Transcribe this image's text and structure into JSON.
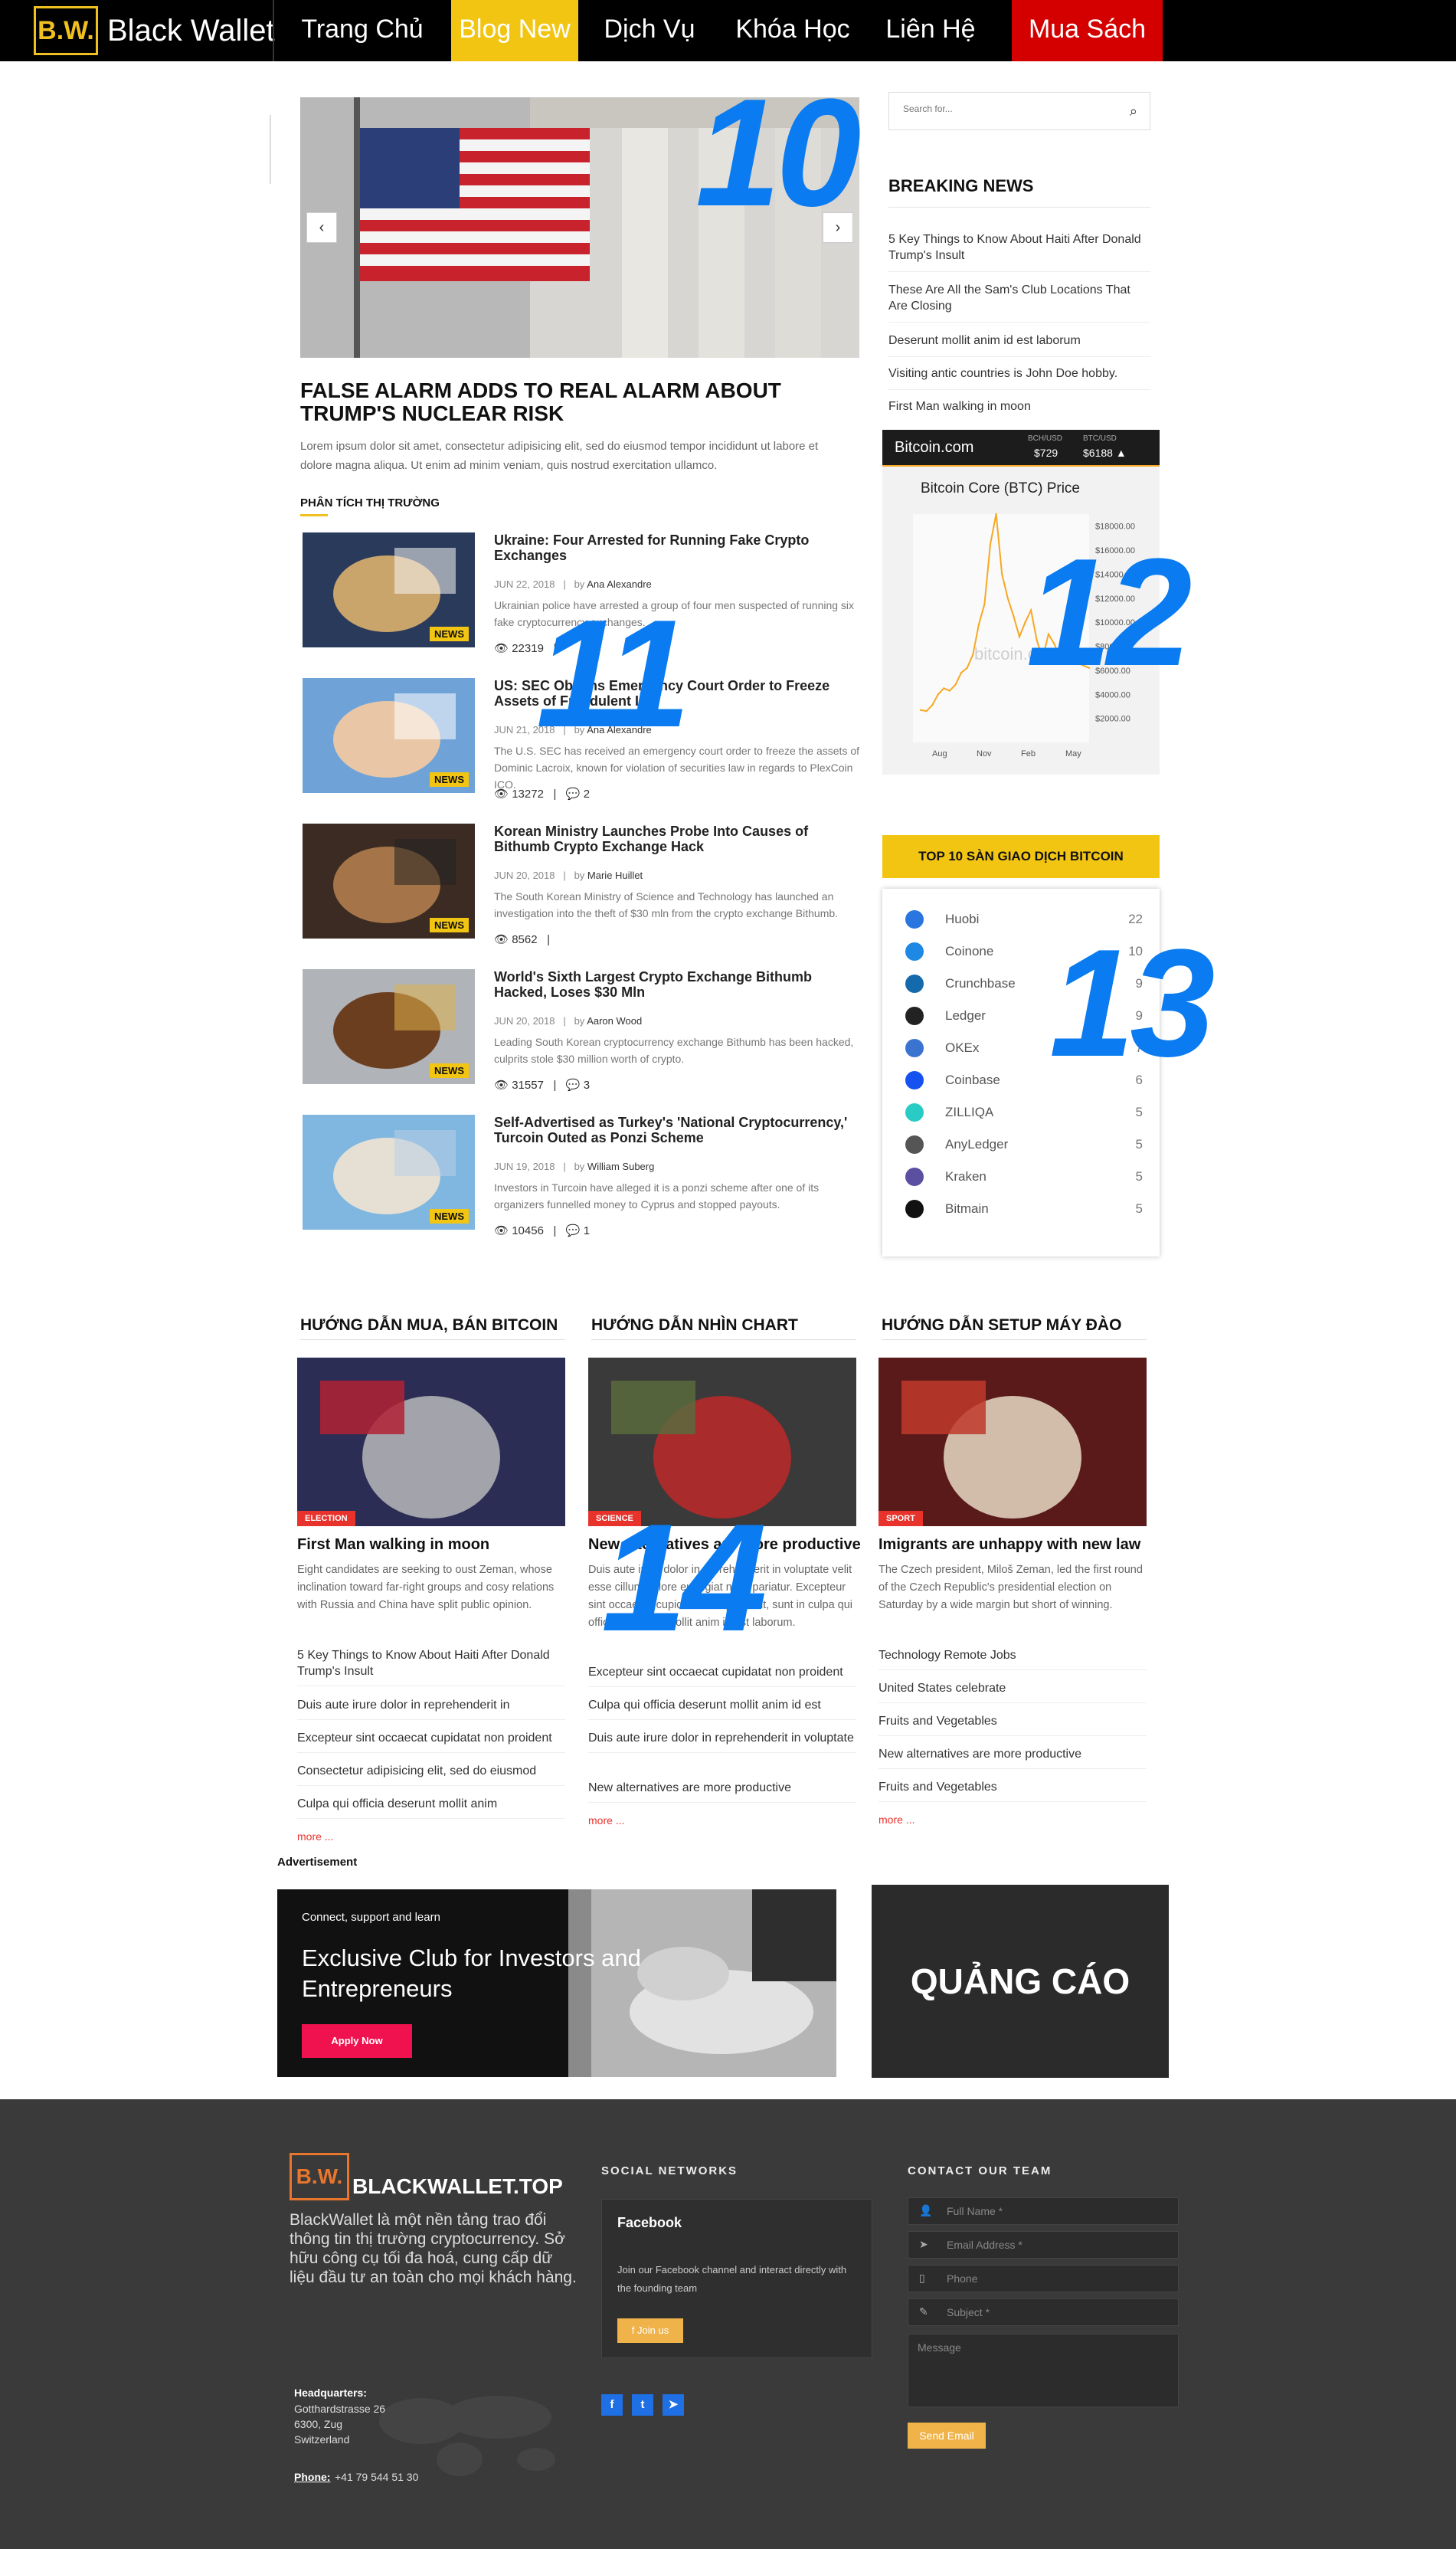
{
  "nav": {
    "logo_mark": "B.W.",
    "logo_text": "Black Wallet",
    "items": [
      "Trang Chủ",
      "Blog New",
      "Dịch Vụ",
      "Khóa Học",
      "Liên Hệ",
      "Mua Sách"
    ],
    "active_index": 1,
    "accent": "#f2c513",
    "cta_color": "#d40000"
  },
  "annotations": [
    "10",
    "11",
    "12",
    "13",
    "14"
  ],
  "hero": {
    "prev_icon": "chevron-left-icon",
    "next_icon": "chevron-right-icon",
    "title": "FALSE ALARM ADDS TO REAL ALARM ABOUT TRUMP'S NUCLEAR RISK",
    "lead": "Lorem ipsum dolor sit amet, consectetur adipisicing elit, sed do eiusmod tempor incididunt ut labore et dolore magna aliqua. Ut enim ad minim veniam, quis nostrud exercitation ullamco."
  },
  "market": {
    "label": "PHÂN TÍCH THỊ TRƯỜNG",
    "articles": [
      {
        "title": "Ukraine: Four Arrested for Running Fake Crypto Exchanges",
        "date": "JUN 22, 2018",
        "by": "by",
        "author": "Ana Alexandre",
        "excerpt": "Ukrainian police have arrested a group of four men suspected of running six fake cryptocurrency exchanges.",
        "views": "22319",
        "comments": "",
        "badge": "NEWS"
      },
      {
        "title": "US: SEC Obtains Emergency Court Order to Freeze Assets of Fraudulent ICO",
        "date": "JUN 21, 2018",
        "by": "by",
        "author": "Ana Alexandre",
        "excerpt": "The U.S. SEC has received an emergency court order to freeze the assets of Dominic Lacroix, known for violation of securities law in regards to PlexCoin ICO.",
        "views": "13272",
        "comments": "2",
        "badge": "NEWS"
      },
      {
        "title": "Korean Ministry Launches Probe Into Causes of Bithumb Crypto Exchange Hack",
        "date": "JUN 20, 2018",
        "by": "by",
        "author": "Marie Huillet",
        "excerpt": "The South Korean Ministry of Science and Technology has launched an investigation into the theft of $30 mln from the crypto exchange Bithumb.",
        "views": "8562",
        "comments": "",
        "badge": "NEWS"
      },
      {
        "title": "World's Sixth Largest Crypto Exchange Bithumb Hacked, Loses $30 Mln",
        "date": "JUN 20, 2018",
        "by": "by",
        "author": "Aaron Wood",
        "excerpt": "Leading South Korean cryptocurrency exchange Bithumb has been hacked, culprits stole $30 million worth of crypto.",
        "views": "31557",
        "comments": "3",
        "badge": "NEWS"
      },
      {
        "title": "Self-Advertised as Turkey's 'National Cryptocurrency,' Turcoin Outed as Ponzi Scheme",
        "date": "JUN 19, 2018",
        "by": "by",
        "author": "William Suberg",
        "excerpt": "Investors in Turcoin have alleged it is a ponzi scheme after one of its organizers funnelled money to Cyprus and stopped payouts.",
        "views": "10456",
        "comments": "1",
        "badge": "NEWS"
      }
    ]
  },
  "sidebar": {
    "search_placeholder": "Search for...",
    "search_icon": "search-icon",
    "breaking_title": "BREAKING NEWS",
    "breaking": [
      "5 Key Things to Know About Haiti After Donald Trump's Insult",
      "These Are All the Sam's Club Locations That Are Closing",
      "Deserunt mollit anim id est laborum",
      "Visiting antic countries is John Doe hobby.",
      "First Man walking in moon"
    ]
  },
  "btc_widget": {
    "brand": "Bitcoin.com",
    "pair1_label": "BCH/USD",
    "pair1_value": "$729",
    "pair2_label": "BTC/USD",
    "pair2_value": "$6188 ▲",
    "chart_title": "Bitcoin Core (BTC) Price",
    "watermark": "bitcoin.com"
  },
  "chart_data": {
    "type": "line",
    "title": "Bitcoin Core (BTC) Price",
    "x_ticks": [
      "Aug",
      "Nov",
      "Feb",
      "May"
    ],
    "y_ticks": [
      "$18000.00",
      "$16000.00",
      "$14000.00",
      "$12000.00",
      "$10000.00",
      "$8000.00",
      "$6000.00",
      "$4000.00",
      "$2000.00"
    ],
    "ylim": [
      0,
      19000
    ],
    "series": [
      {
        "values": [
          2700,
          2600,
          3100,
          4000,
          4500,
          4300,
          4800,
          5800,
          6200,
          7300,
          9800,
          11500,
          16500,
          19000,
          14000,
          12000,
          10500,
          8800,
          10000,
          11000,
          8500,
          7000,
          9000,
          8200,
          7000,
          9400,
          7500,
          6600,
          6400,
          6200
        ]
      }
    ],
    "color": "#f7a823",
    "grid": false
  },
  "exchanges": {
    "title": "TOP 10 SÀN GIAO DỊCH BITCOIN",
    "rows": [
      {
        "name": "Huobi",
        "count": "22",
        "color": "#2a76e0"
      },
      {
        "name": "Coinone",
        "count": "10",
        "color": "#1e88e5"
      },
      {
        "name": "Crunchbase",
        "count": "9",
        "color": "#146aab"
      },
      {
        "name": "Ledger",
        "count": "9",
        "color": "#222222"
      },
      {
        "name": "OKEx",
        "count": "7",
        "color": "#3b74d0"
      },
      {
        "name": "Coinbase",
        "count": "6",
        "color": "#1652f0"
      },
      {
        "name": "ZILLIQA",
        "count": "5",
        "color": "#29ccc4"
      },
      {
        "name": "AnyLedger",
        "count": "5",
        "color": "#555555"
      },
      {
        "name": "Kraken",
        "count": "5",
        "color": "#5a4fa0"
      },
      {
        "name": "Bitmain",
        "count": "5",
        "color": "#111111"
      }
    ]
  },
  "columns": [
    {
      "heading": "HƯỚNG DẪN MUA, BÁN BITCOIN",
      "badge": "ELECTION",
      "title": "First Man walking in moon",
      "excerpt": "Eight candidates are seeking to oust Zeman, whose inclination toward far-right groups and cosy relations with Russia and China have split public opinion.",
      "links": [
        "5 Key Things to Know About Haiti After Donald Trump's Insult",
        "Duis aute irure dolor in reprehenderit in",
        "Excepteur sint occaecat cupidatat non proident",
        "Consectetur adipisicing elit, sed do eiusmod",
        "Culpa qui officia deserunt mollit anim"
      ],
      "more": "more ..."
    },
    {
      "heading": "HƯỚNG DẪN NHÌN CHART",
      "badge": "SCIENCE",
      "title": "New alternatives are more productive",
      "excerpt": "Duis aute irure dolor in reprehenderit in voluptate velit esse cillum dolore eu fugiat nulla pariatur. Excepteur sint occaecat cupidatat non proident, sunt in culpa qui officia deserunt mollit anim id est laborum.",
      "links": [
        "Excepteur sint occaecat cupidatat non proident",
        "Culpa qui officia deserunt mollit anim id est",
        "Duis aute irure dolor in reprehenderit in voluptate",
        "New alternatives are more productive"
      ],
      "more": "more ..."
    },
    {
      "heading": "HƯỚNG DẪN SETUP MÁY ĐÀO",
      "badge": "SPORT",
      "title": "Imigrants are unhappy with new law",
      "excerpt": "The Czech president, Miloš Zeman, led the first round of the Czech Republic's presidential election on Saturday by a wide margin but short of winning.",
      "links": [
        "Technology Remote Jobs",
        "United States celebrate",
        "Fruits and Vegetables",
        "New alternatives are more productive",
        "Fruits and Vegetables"
      ],
      "more": "more ..."
    }
  ],
  "ads": {
    "label": "Advertisement",
    "small": "Connect, support and learn",
    "headline": "Exclusive Club for Investors and Entrepreneurs",
    "cta": "Apply Now",
    "right_text": "QUẢNG CÁO"
  },
  "footer": {
    "logo_mark": "B.W.",
    "logo_text": "BLACKWALLET.TOP",
    "about": "BlackWallet là một nền tảng trao đổi thông tin thị trường cryptocurrency. Sở hữu công cụ tối đa hoá, cung cấp dữ liệu đầu tư an toàn cho mọi khách hàng.",
    "hq_label": "Headquarters:",
    "hq_lines": [
      "Gotthardstrasse 26",
      "6300, Zug",
      "Switzerland"
    ],
    "phone_label": "Phone:",
    "phone": "+41 79 544 51 30",
    "social_title": "SOCIAL NETWORKS",
    "fb_title": "Facebook",
    "fb_text": "Join our Facebook channel and interact directly with the founding team",
    "fb_button": "Join us",
    "contact_title": "CONTACT OUR TEAM",
    "fields": [
      "Full Name *",
      "Email Address *",
      "Phone",
      "Subject *"
    ],
    "message": "Message",
    "send": "Send Email"
  }
}
